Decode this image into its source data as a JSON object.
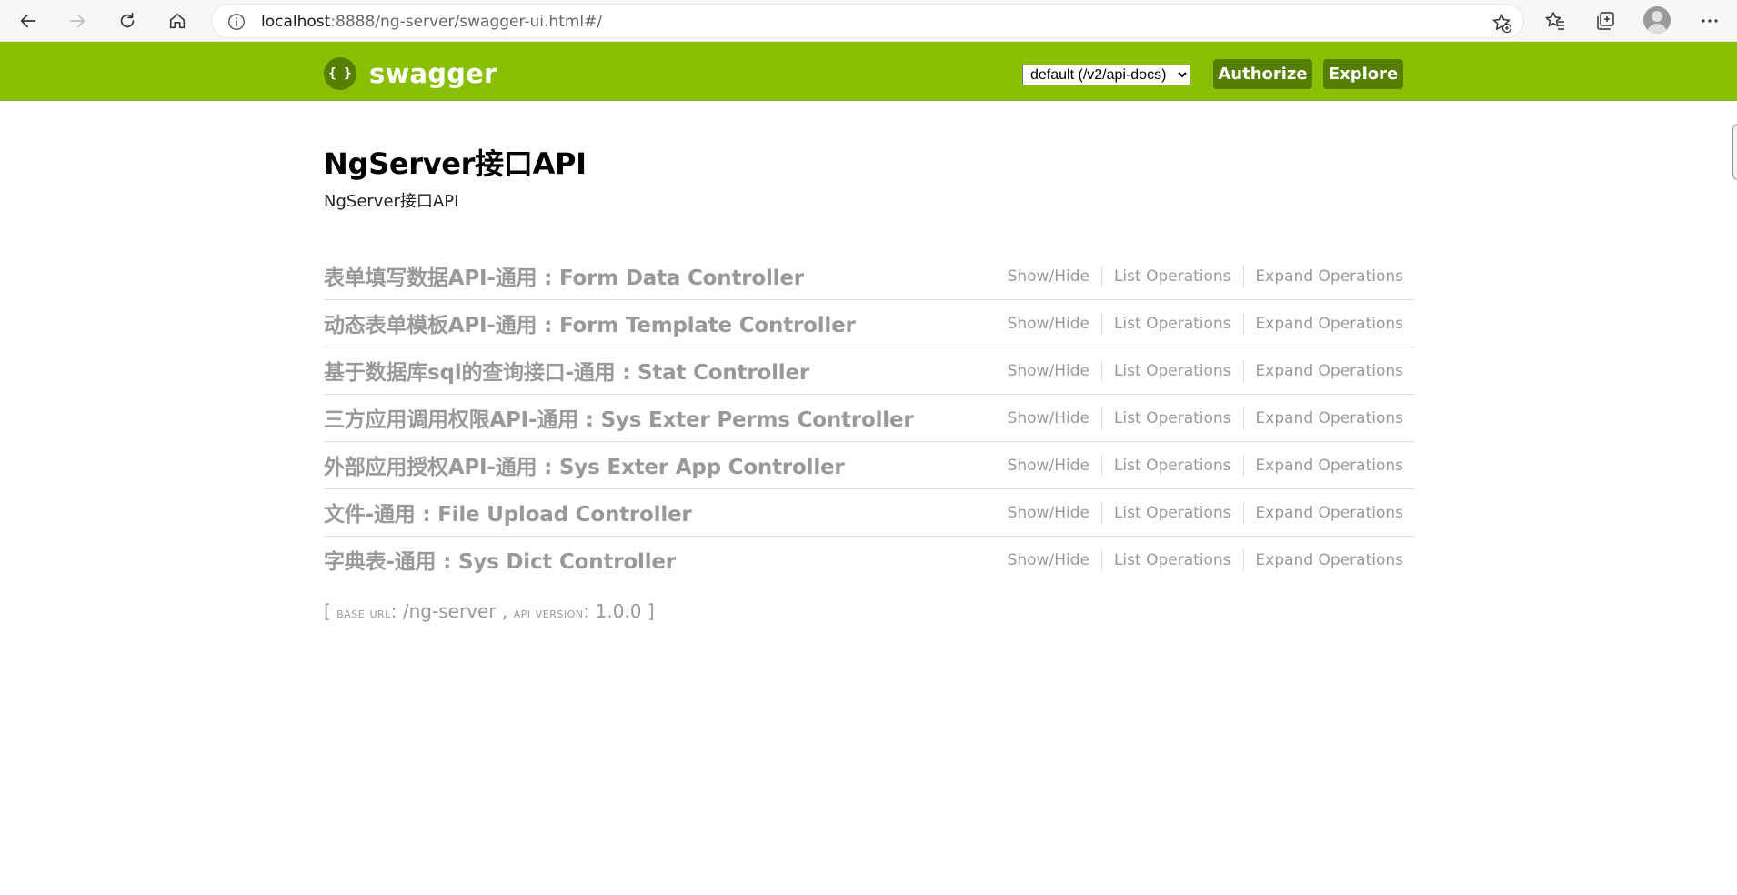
{
  "browser": {
    "url_host": "localhost",
    "url_rest": ":8888/ng-server/swagger-ui.html#/"
  },
  "header": {
    "logo_mark": "{ }",
    "logo_text": "swagger",
    "api_select": {
      "selected": "default (/v2/api-docs)",
      "options": [
        "default (/v2/api-docs)"
      ]
    },
    "authorize_label": "Authorize",
    "explore_label": "Explore"
  },
  "info": {
    "title": "NgServer接口API",
    "description": "NgServer接口API"
  },
  "resources": [
    {
      "name": "表单填写数据API-通用 : Form Data Controller",
      "show_hide": "Show/Hide",
      "list_ops": "List Operations",
      "expand_ops": "Expand Operations"
    },
    {
      "name": "动态表单模板API-通用 : Form Template Controller",
      "show_hide": "Show/Hide",
      "list_ops": "List Operations",
      "expand_ops": "Expand Operations"
    },
    {
      "name": "基于数据库sql的查询接口-通用 : Stat Controller",
      "show_hide": "Show/Hide",
      "list_ops": "List Operations",
      "expand_ops": "Expand Operations"
    },
    {
      "name": "三方应用调用权限API-通用 : Sys Exter Perms Controller",
      "show_hide": "Show/Hide",
      "list_ops": "List Operations",
      "expand_ops": "Expand Operations"
    },
    {
      "name": "外部应用授权API-通用 : Sys Exter App Controller",
      "show_hide": "Show/Hide",
      "list_ops": "List Operations",
      "expand_ops": "Expand Operations"
    },
    {
      "name": "文件-通用 : File Upload Controller",
      "show_hide": "Show/Hide",
      "list_ops": "List Operations",
      "expand_ops": "Expand Operations"
    },
    {
      "name": "字典表-通用 : Sys Dict Controller",
      "show_hide": "Show/Hide",
      "list_ops": "List Operations",
      "expand_ops": "Expand Operations"
    }
  ],
  "footer": {
    "open_bracket": "[",
    "base_url_label": "base url",
    "base_url_value": "/ng-server",
    "separator": ",",
    "api_version_label": "api version",
    "api_version_value": "1.0.0",
    "close_bracket": "]"
  },
  "colors": {
    "header_bg": "#89bf04",
    "header_button_bg": "#547f00",
    "resource_text": "#999999"
  },
  "icons": [
    "back-arrow-icon",
    "forward-arrow-icon",
    "refresh-icon",
    "home-icon",
    "info-icon",
    "add-favorite-icon",
    "favorites-icon",
    "collections-icon",
    "profile-icon",
    "more-icon"
  ]
}
